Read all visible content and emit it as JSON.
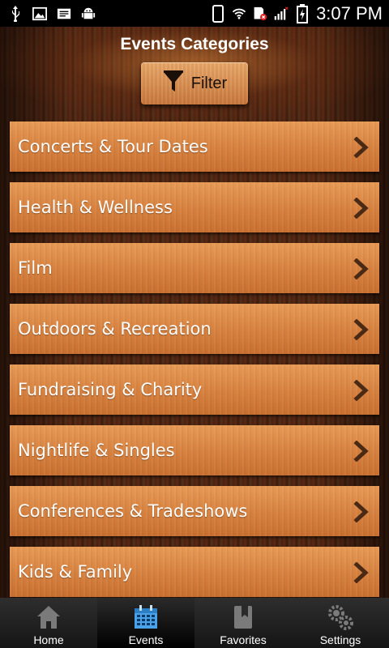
{
  "status_bar": {
    "time": "3:07 PM",
    "icons": [
      "usb-icon",
      "image-icon",
      "message-icon",
      "android-debug-icon",
      "phone-icon",
      "wifi-icon",
      "sd-card-error-icon",
      "signal-icon",
      "battery-icon"
    ]
  },
  "header": {
    "title": "Events Categories",
    "filter_label": "Filter"
  },
  "categories": [
    {
      "label": "Concerts & Tour Dates"
    },
    {
      "label": "Health & Wellness"
    },
    {
      "label": "Film"
    },
    {
      "label": "Outdoors & Recreation"
    },
    {
      "label": "Fundraising & Charity"
    },
    {
      "label": "Nightlife & Singles"
    },
    {
      "label": "Conferences & Tradeshows"
    },
    {
      "label": "Kids & Family"
    }
  ],
  "nav": {
    "tabs": [
      {
        "label": "Home",
        "icon": "home-icon",
        "active": false
      },
      {
        "label": "Events",
        "icon": "calendar-icon",
        "active": true
      },
      {
        "label": "Favorites",
        "icon": "bookmark-icon",
        "active": false
      },
      {
        "label": "Settings",
        "icon": "gears-icon",
        "active": false
      }
    ]
  },
  "colors": {
    "item_orange": "#d6803e",
    "wood_dark": "#4a2212",
    "nav_active_icon": "#4aa3e8"
  }
}
